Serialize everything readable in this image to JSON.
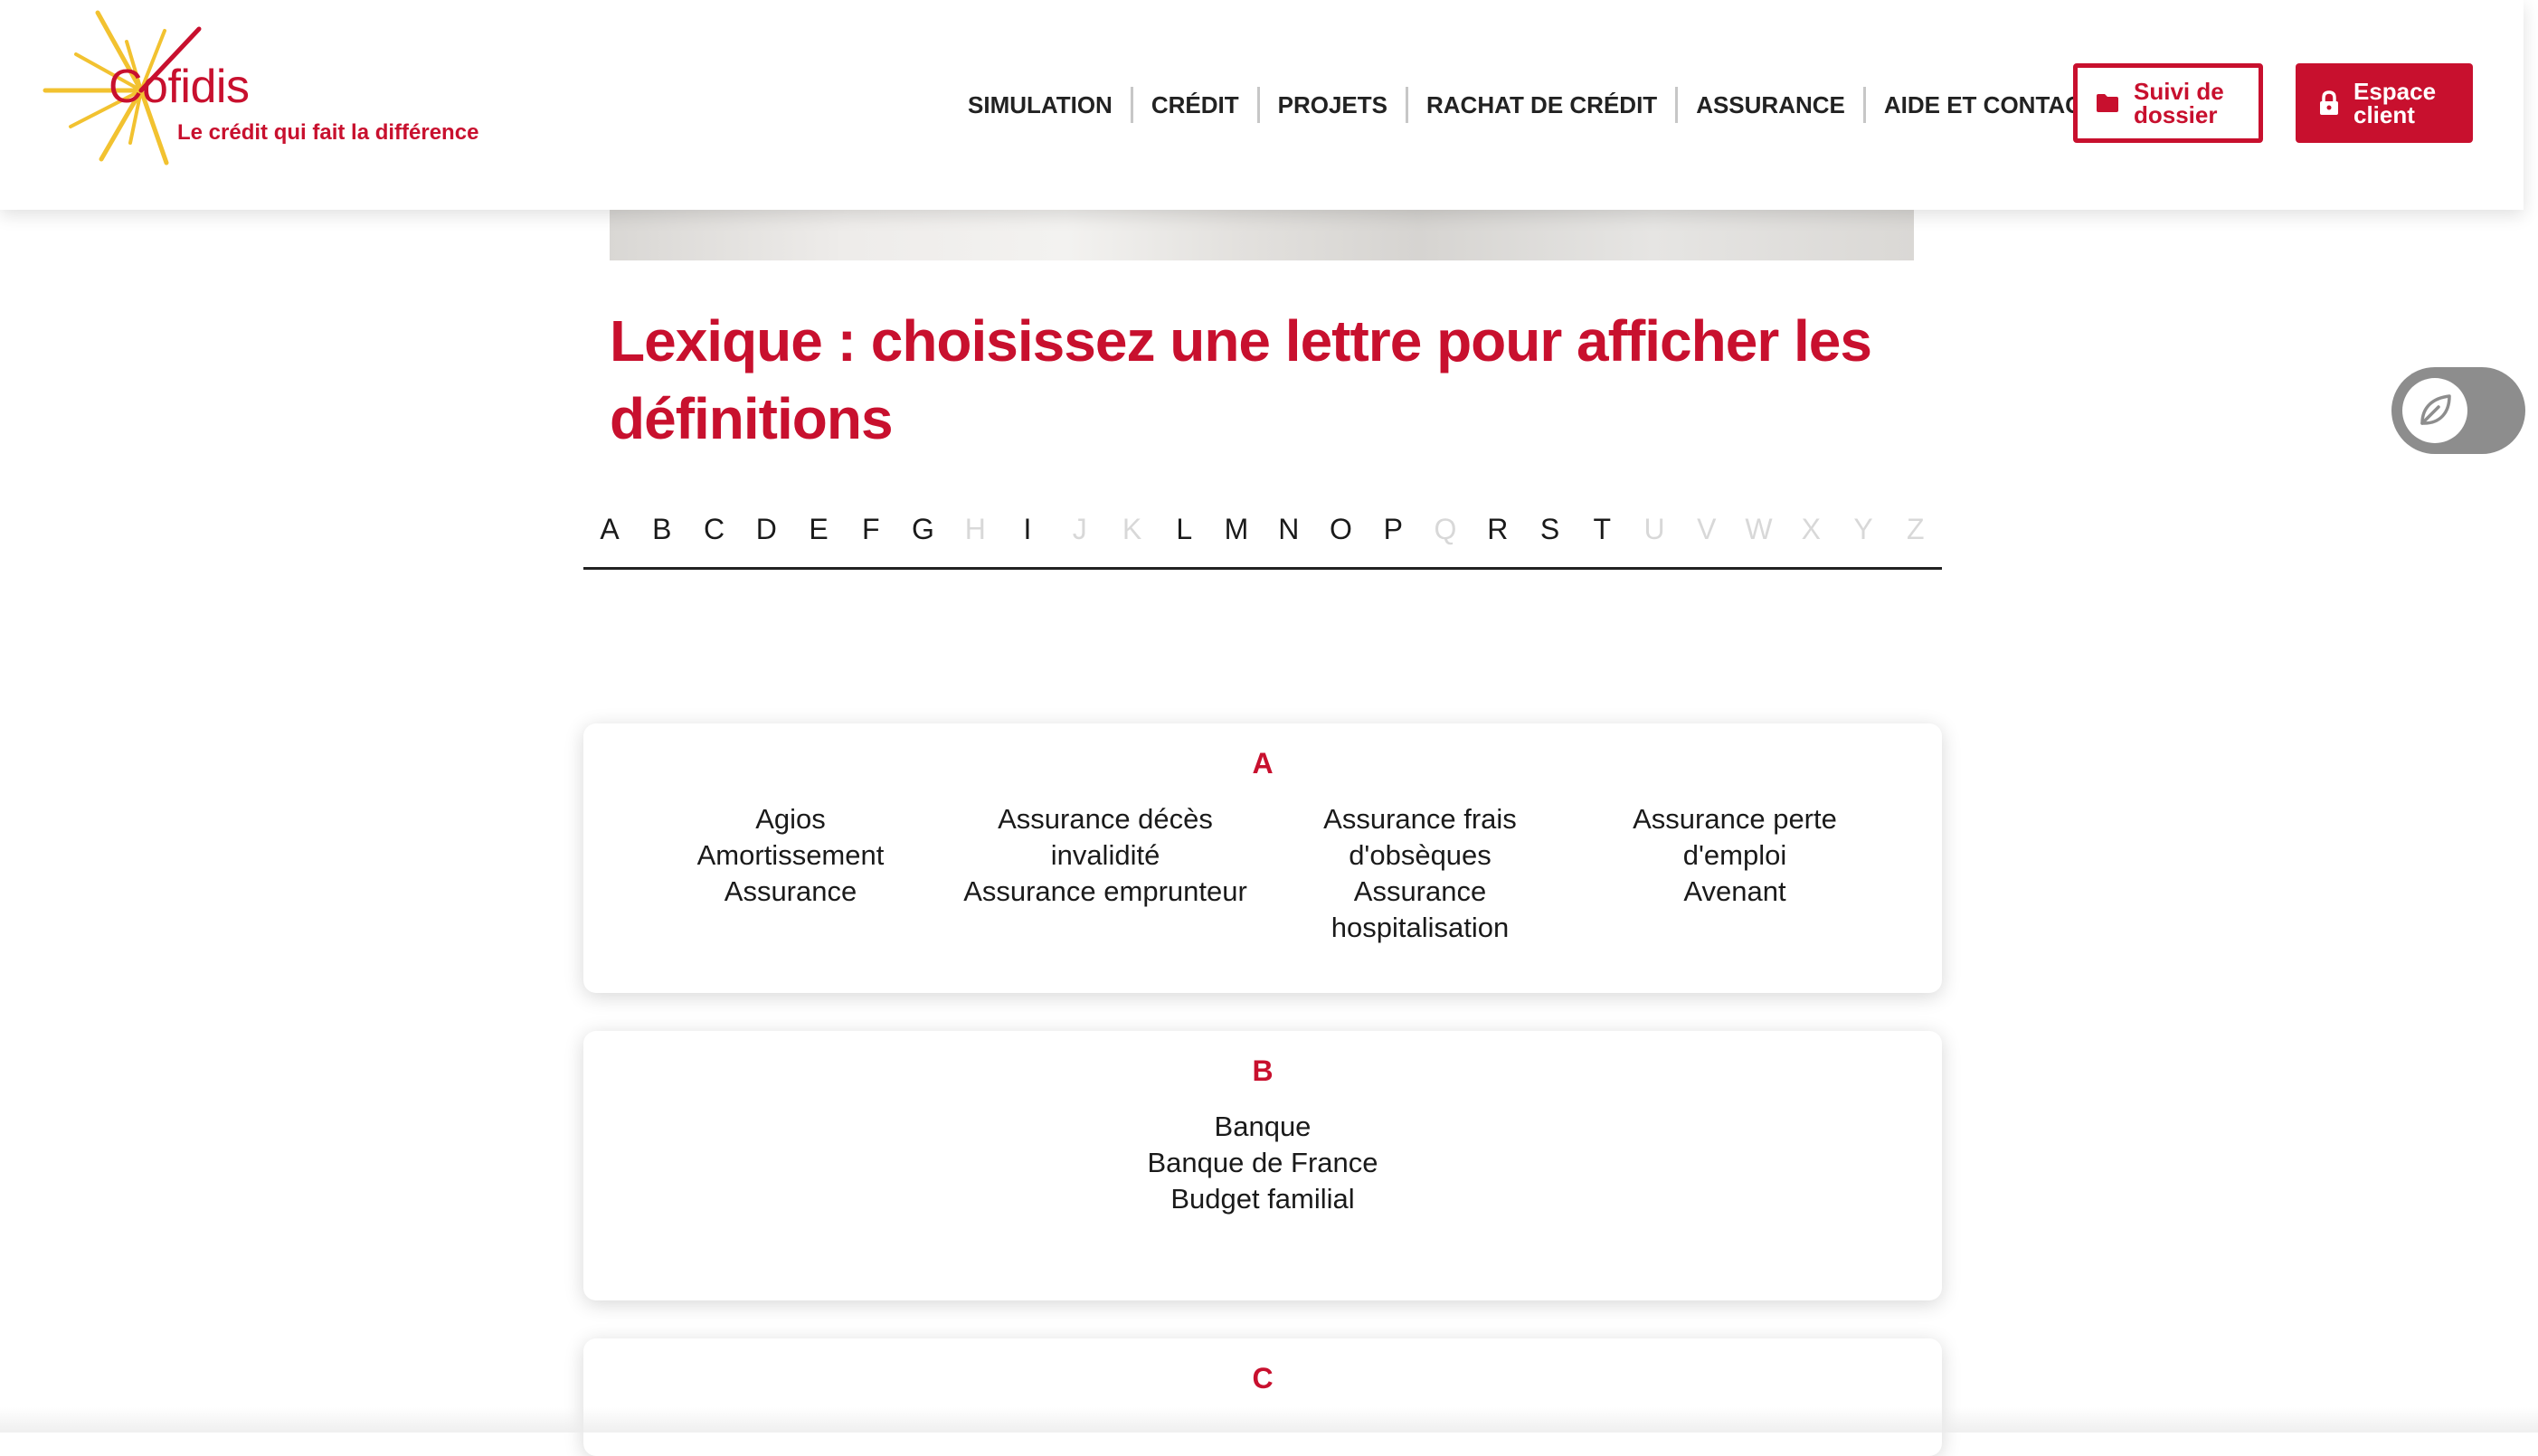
{
  "brand": {
    "name": "Cofidis",
    "tagline": "Le crédit qui fait la différence",
    "colors": {
      "primary": "#c8102e",
      "sun": "#f2c230"
    }
  },
  "nav": {
    "items": [
      "SIMULATION",
      "CRÉDIT",
      "PROJETS",
      "RACHAT DE CRÉDIT",
      "ASSURANCE",
      "AIDE ET CONTACT"
    ],
    "suivi_label": "Suivi de dossier",
    "espace_label": "Espace client"
  },
  "page": {
    "title": "Lexique : choisissez une lettre pour afficher les définitions"
  },
  "alphabet": [
    {
      "letter": "A",
      "enabled": true
    },
    {
      "letter": "B",
      "enabled": true
    },
    {
      "letter": "C",
      "enabled": true
    },
    {
      "letter": "D",
      "enabled": true
    },
    {
      "letter": "E",
      "enabled": true
    },
    {
      "letter": "F",
      "enabled": true
    },
    {
      "letter": "G",
      "enabled": true
    },
    {
      "letter": "H",
      "enabled": false
    },
    {
      "letter": "I",
      "enabled": true
    },
    {
      "letter": "J",
      "enabled": false
    },
    {
      "letter": "K",
      "enabled": false
    },
    {
      "letter": "L",
      "enabled": true
    },
    {
      "letter": "M",
      "enabled": true
    },
    {
      "letter": "N",
      "enabled": true
    },
    {
      "letter": "O",
      "enabled": true
    },
    {
      "letter": "P",
      "enabled": true
    },
    {
      "letter": "Q",
      "enabled": false
    },
    {
      "letter": "R",
      "enabled": true
    },
    {
      "letter": "S",
      "enabled": true
    },
    {
      "letter": "T",
      "enabled": true
    },
    {
      "letter": "U",
      "enabled": false
    },
    {
      "letter": "V",
      "enabled": false
    },
    {
      "letter": "W",
      "enabled": false
    },
    {
      "letter": "X",
      "enabled": false
    },
    {
      "letter": "Y",
      "enabled": false
    },
    {
      "letter": "Z",
      "enabled": false
    }
  ],
  "sections": [
    {
      "letter": "A",
      "columns": [
        [
          "Agios",
          "Amortissement",
          "Assurance"
        ],
        [
          "Assurance décès invalidité",
          "Assurance emprunteur"
        ],
        [
          "Assurance frais d'obsèques",
          "Assurance hospitalisation"
        ],
        [
          "Assurance perte d'emploi",
          "Avenant"
        ]
      ]
    },
    {
      "letter": "B",
      "columns": [
        [
          "Banque",
          "Banque de France",
          "Budget familial"
        ]
      ]
    },
    {
      "letter": "C",
      "columns": []
    }
  ],
  "icons": {
    "suivi": "folder-icon",
    "espace": "lock-icon",
    "eco": "leaf-icon"
  }
}
